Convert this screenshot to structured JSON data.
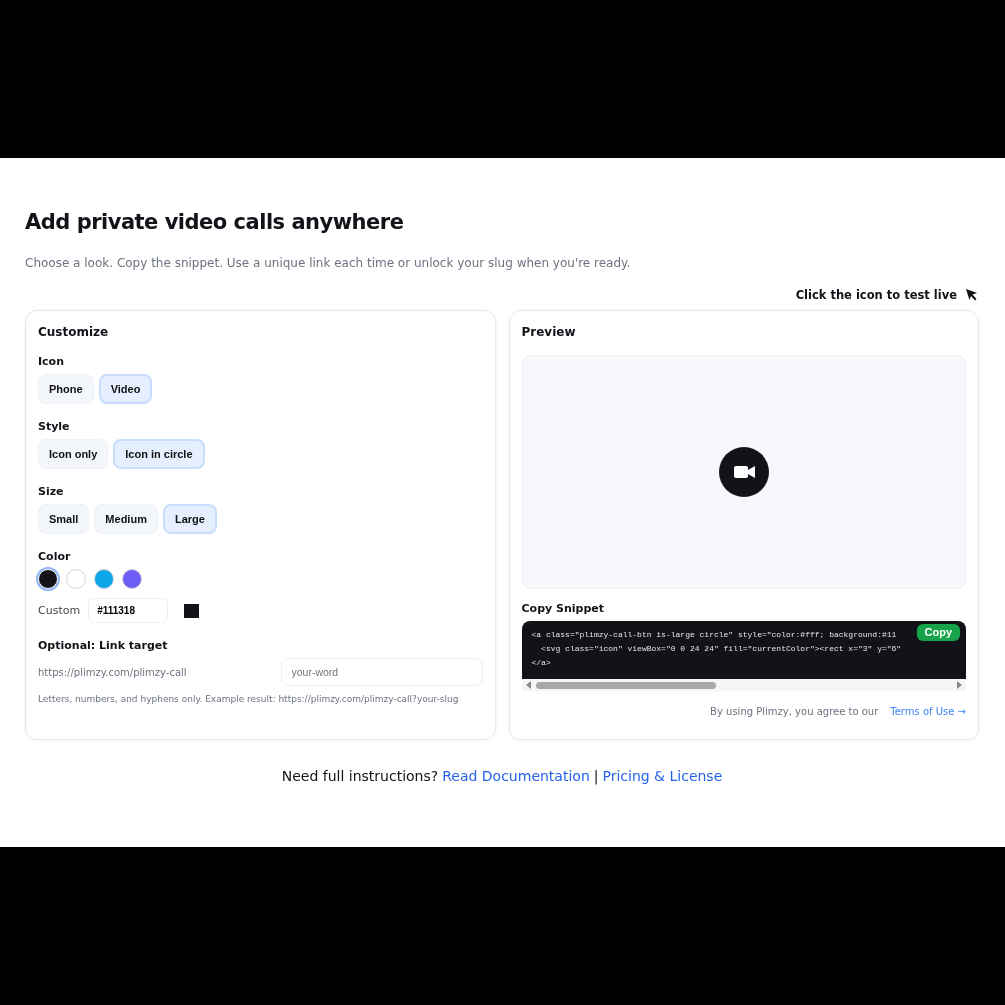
{
  "title": "Add private video calls anywhere",
  "subtitle": "Choose a look. Copy the snippet. Use a unique link each time or unlock your slug when you're ready.",
  "hint": "Click the icon to test live",
  "customize": {
    "title": "Customize",
    "groups": [
      {
        "label": "Icon",
        "options": [
          {
            "label": "Phone",
            "selected": false
          },
          {
            "label": "Video",
            "selected": true
          }
        ]
      },
      {
        "label": "Style",
        "options": [
          {
            "label": "Icon only",
            "selected": false
          },
          {
            "label": "Icon in circle",
            "selected": true
          }
        ]
      },
      {
        "label": "Size",
        "options": [
          {
            "label": "Small",
            "selected": false
          },
          {
            "label": "Medium",
            "selected": false
          },
          {
            "label": "Large",
            "selected": true
          }
        ]
      }
    ],
    "color": {
      "label": "Color",
      "swatches": [
        {
          "color": "#111318",
          "selected": true
        },
        {
          "color": "#ffffff",
          "selected": false
        },
        {
          "color": "#0ea5e9",
          "selected": false
        },
        {
          "color": "#6d5cf6",
          "selected": false
        }
      ],
      "custom_label": "Custom",
      "custom_value": "#111318"
    },
    "link": {
      "label": "Optional: Link target",
      "base": "https://plimzy.com/plimzy-call",
      "placeholder": "your-word",
      "help": "Letters, numbers, and hyphens only. Example result: https://plimzy.com/plimzy-call?your-slug"
    }
  },
  "preview": {
    "title": "Preview",
    "snippet_label": "Copy Snippet",
    "code_lines": [
      "<a class=\"plimzy-call-btn is-large circle\" style=\"color:#fff; background:#11",
      "  <svg class=\"icon\" viewBox=\"0 0 24 24\" fill=\"currentColor\"><rect x=\"3\" y=\"6\"",
      "</a>"
    ],
    "copy_button": "Copy",
    "terms_text": "By using Plimzy, you agree to our",
    "terms_link": "Terms of Use →"
  },
  "footer": {
    "text": "Need full instructions?",
    "links": [
      "Read Documentation",
      "Pricing & License"
    ],
    "separator": "|"
  }
}
